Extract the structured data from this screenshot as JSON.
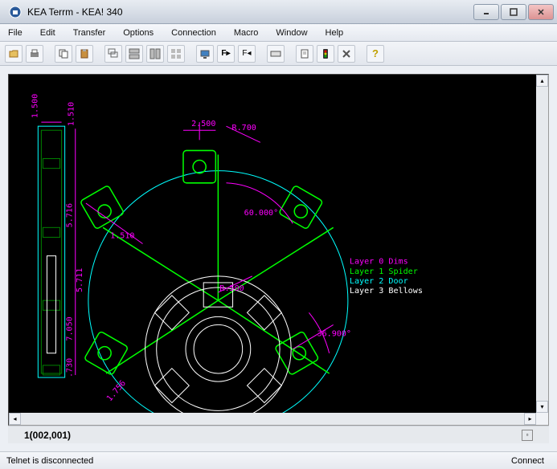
{
  "window": {
    "title": "KEA Terrm - KEA! 340"
  },
  "menu": {
    "file": "File",
    "edit": "Edit",
    "transfer": "Transfer",
    "options": "Options",
    "connection": "Connection",
    "macro": "Macro",
    "window": "Window",
    "help": "Help"
  },
  "toolbar_icons": {
    "open": "open-icon",
    "print": "print-icon",
    "copy": "copy-icon",
    "paste": "paste-icon",
    "cascade": "cascade-icon",
    "tile1": "tile1-icon",
    "tile2": "tile2-icon",
    "tile3": "tile3-icon",
    "display": "display-icon",
    "fontbold": "font-bold-icon",
    "fontital": "font-italic-icon",
    "keyboard": "keyboard-icon",
    "script": "script-icon",
    "traffic": "traffic-icon",
    "cancel": "cancel-icon",
    "question": "help-icon"
  },
  "canvas": {
    "dims": {
      "d1": "1.500",
      "d2": "1.510",
      "d3": "2.500",
      "r700": "R.700",
      "d5716": "5.716",
      "d5711": "5.711",
      "d1510": "1.510",
      "r500": "R.500",
      "ang60": "60.000°",
      "ang36": "36.900°",
      "d7050": "7.050",
      "d730": ".730",
      "d1756": "1.756"
    },
    "legend": {
      "l0": "Layer 0 Dims",
      "l1": "Layer 1 Spider",
      "l2": "Layer 2 Door",
      "l3": "Layer 3 Bellows"
    }
  },
  "coord": "1(002,001)",
  "status": {
    "text": "Telnet is disconnected",
    "connect": "Connect"
  },
  "colors": {
    "magenta": "#ff00ff",
    "green": "#00ff00",
    "cyan": "#00ffff",
    "white": "#ffffff",
    "darkgreen": "#008000"
  }
}
